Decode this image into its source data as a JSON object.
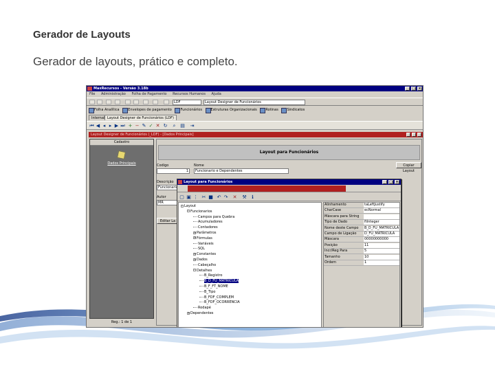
{
  "slide": {
    "title": "Gerador de Layouts",
    "subtitle": "Gerador de layouts, prático e completo."
  },
  "app": {
    "window_title": "MaxRecursos - Versão 3.18b",
    "menu": [
      "File",
      "Administração",
      "Folha de Pagamento",
      "Recursos Humanos",
      "Ajuda"
    ],
    "toolbar": {
      "code_field": "LDF",
      "name_field": "Layout Designer de Funcionários"
    },
    "nav_items": [
      "Folha Analítica",
      "Envelopes de pagamento",
      "Funcionários",
      "Estruturas Organizacionais",
      "Rotinas",
      "Sindicatos"
    ],
    "tabs": [
      "Internal",
      "Layout Designer de Funcionários (LDF)"
    ],
    "child_window_title": "Layout Designer de Funcionários (_LDF) - [Dados Principais]",
    "left_panel": {
      "header": "Cadastro",
      "item_label": "Dados Principais",
      "footer": "Reg.: 1 de 1"
    },
    "form": {
      "banner": "Layout para Funcionários",
      "copy_button": "Copiar Layout",
      "codigo_label": "Codigo",
      "codigo_value": "1",
      "nome_label": "Nome",
      "nome_value": "Funcionario e Dependentes",
      "descricao_label": "Descrição",
      "descricao_value": "Funcionario",
      "autor_label": "Autor",
      "autor_value": "MR",
      "edit_button": "Editar La"
    },
    "sub_window": {
      "title": "Layout para Funcionários",
      "tree": [
        {
          "label": "Layout",
          "depth": 0,
          "expander": "-"
        },
        {
          "label": "Funcionarios",
          "depth": 1,
          "expander": "-"
        },
        {
          "label": "Campos para Quebra",
          "depth": 2,
          "expander": ""
        },
        {
          "label": "Acumuladores",
          "depth": 2,
          "expander": ""
        },
        {
          "label": "Contadores",
          "depth": 2,
          "expander": ""
        },
        {
          "label": "Parâmetros",
          "depth": 2,
          "expander": "+"
        },
        {
          "label": "Fórmulas",
          "depth": 2,
          "expander": "+"
        },
        {
          "label": "Variáveis",
          "depth": 2,
          "expander": ""
        },
        {
          "label": "SQL",
          "depth": 2,
          "expander": ""
        },
        {
          "label": "Constantes",
          "depth": 2,
          "expander": "+"
        },
        {
          "label": "Dados",
          "depth": 2,
          "expander": "+"
        },
        {
          "label": "Cabeçalho",
          "depth": 2,
          "expander": ""
        },
        {
          "label": "Detalhes",
          "depth": 2,
          "expander": "-"
        },
        {
          "label": "B_Registro",
          "depth": 3,
          "expander": ""
        },
        {
          "label": "B_D_FU_MATRICULA",
          "depth": 3,
          "expander": "",
          "selected": true
        },
        {
          "label": "B_F_FT_NOME",
          "depth": 3,
          "expander": ""
        },
        {
          "label": "B_Tipo",
          "depth": 3,
          "expander": ""
        },
        {
          "label": "B_FDF_COMPLEM",
          "depth": 3,
          "expander": ""
        },
        {
          "label": "B_FDF_OCORRENCIA",
          "depth": 3,
          "expander": ""
        },
        {
          "label": "Rodapé",
          "depth": 2,
          "expander": ""
        },
        {
          "label": "Dependentes",
          "depth": 1,
          "expander": "+"
        }
      ],
      "properties": [
        {
          "key": "Alinhamento",
          "value": "taLeftJustify"
        },
        {
          "key": "CharCase",
          "value": "ecNormal"
        },
        {
          "key": "Máscara para String",
          "value": ""
        },
        {
          "key": "Tipo de Dado",
          "value": "ftInteger"
        },
        {
          "key": "Nome deste Campo",
          "value": "B_D_FU_MATRICULA"
        },
        {
          "key": "Campo de Ligação",
          "value": "D_FU_MATRICULA"
        },
        {
          "key": "Máscara",
          "value": "00000000000"
        },
        {
          "key": "Posição",
          "value": "11"
        },
        {
          "key": "Incr/Reg Para",
          "value": "5"
        },
        {
          "key": "Tamanho",
          "value": "10"
        },
        {
          "key": "Ordem",
          "value": "1"
        }
      ]
    }
  }
}
